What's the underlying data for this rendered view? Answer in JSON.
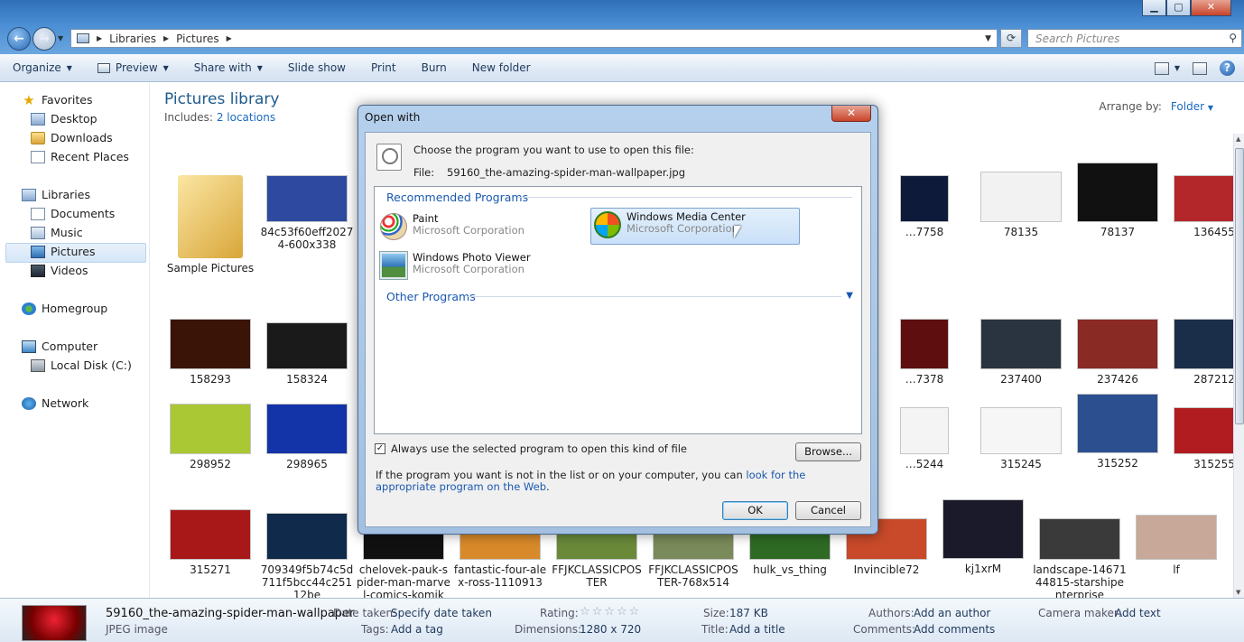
{
  "window": {
    "minimize": "▁",
    "maximize": "▢",
    "close": "✕"
  },
  "address": {
    "parts": [
      "Libraries",
      "Pictures"
    ],
    "search_placeholder": "Search Pictures"
  },
  "toolbar": {
    "organize": "Organize",
    "preview": "Preview",
    "share_with": "Share with",
    "slide_show": "Slide show",
    "print": "Print",
    "burn": "Burn",
    "new_folder": "New folder"
  },
  "sidebar": {
    "favorites": "Favorites",
    "desktop": "Desktop",
    "downloads": "Downloads",
    "recent_places": "Recent Places",
    "libraries": "Libraries",
    "documents": "Documents",
    "music": "Music",
    "pictures": "Pictures",
    "videos": "Videos",
    "homegroup": "Homegroup",
    "computer": "Computer",
    "local_disk": "Local Disk (C:)",
    "network": "Network"
  },
  "library": {
    "title": "Pictures library",
    "includes_label": "Includes:",
    "includes_link": "2 locations",
    "arrange_label": "Arrange by:",
    "arrange_value": "Folder"
  },
  "files": [
    {
      "name": "Sample Pictures",
      "color": "#d8a63a"
    },
    {
      "name": "84c53f60eff20274-600x338",
      "color": "#2d4aa0"
    },
    {
      "name": "…7758",
      "color": "#0d1a3a"
    },
    {
      "name": "78135",
      "color": "#f2f2f2"
    },
    {
      "name": "78137",
      "color": "#111111"
    },
    {
      "name": "136455",
      "color": "#b3262a"
    },
    {
      "name": "158293",
      "color": "#3a1406"
    },
    {
      "name": "158324",
      "color": "#1a1a1a"
    },
    {
      "name": "…7378",
      "color": "#5e0e0e"
    },
    {
      "name": "237400",
      "color": "#2a3440"
    },
    {
      "name": "237426",
      "color": "#8a2a24"
    },
    {
      "name": "287212",
      "color": "#1a2e4a"
    },
    {
      "name": "298952",
      "color": "#a9c834"
    },
    {
      "name": "298965",
      "color": "#1234a8"
    },
    {
      "name": "…5244",
      "color": "#f4f4f4"
    },
    {
      "name": "315245",
      "color": "#f6f6f6"
    },
    {
      "name": "315252",
      "color": "#2b4f8f"
    },
    {
      "name": "315255",
      "color": "#b01c20"
    },
    {
      "name": "315271",
      "color": "#a81818"
    },
    {
      "name": "709349f5b74c5d711f5bcc44c25112be",
      "color": "#0f2a4a"
    },
    {
      "name": "chelovek-pauk-spider-man-marvel-comics-komik",
      "color": "#111111"
    },
    {
      "name": "fantastic-four-alex-ross-1110913",
      "color": "#d88a2a"
    },
    {
      "name": "FFJKCLASSICPOSTER",
      "color": "#6a8a3a"
    },
    {
      "name": "FFJKCLASSICPOSTER-768x514",
      "color": "#7a8a5a"
    },
    {
      "name": "hulk_vs_thing",
      "color": "#2e6a24"
    },
    {
      "name": "Invincible72",
      "color": "#c84a2a"
    },
    {
      "name": "kj1xrM",
      "color": "#1a1a2a"
    },
    {
      "name": "landscape-1467144815-starshipenterprise",
      "color": "#3a3a3a"
    },
    {
      "name": "lf",
      "color": "#c8a898"
    }
  ],
  "details": {
    "filename": "59160_the-amazing-spider-man-wallpaper",
    "filetype": "JPEG image",
    "date_taken_label": "Date taken:",
    "date_taken": "Specify date taken",
    "tags_label": "Tags:",
    "tags": "Add a tag",
    "rating_label": "Rating:",
    "rating_stars": "☆☆☆☆☆",
    "dimensions_label": "Dimensions:",
    "dimensions": "1280 x 720",
    "size_label": "Size:",
    "size": "187 KB",
    "title_label": "Title:",
    "title": "Add a title",
    "authors_label": "Authors:",
    "authors": "Add an author",
    "comments_label": "Comments:",
    "comments": "Add comments",
    "camera_label": "Camera maker:",
    "camera": "Add text"
  },
  "dialog": {
    "title": "Open with",
    "close": "✕",
    "prompt": "Choose the program you want to use to open this file:",
    "file_label": "File:",
    "file_name": "59160_the-amazing-spider-man-wallpaper.jpg",
    "recommended": "Recommended Programs",
    "programs": [
      {
        "name": "Paint",
        "company": "Microsoft Corporation"
      },
      {
        "name": "Windows Media Center",
        "company": "Microsoft Corporation"
      },
      {
        "name": "Windows Photo Viewer",
        "company": "Microsoft Corporation"
      }
    ],
    "other": "Other Programs",
    "always_use": "Always use the selected program to open this kind of file",
    "always_checked": "✓",
    "browse": "Browse...",
    "note_text": "If the program you want is not in the list or on your computer, you can ",
    "note_link": "look for the appropriate program on the Web",
    "note_end": ".",
    "ok": "OK",
    "cancel": "Cancel"
  }
}
